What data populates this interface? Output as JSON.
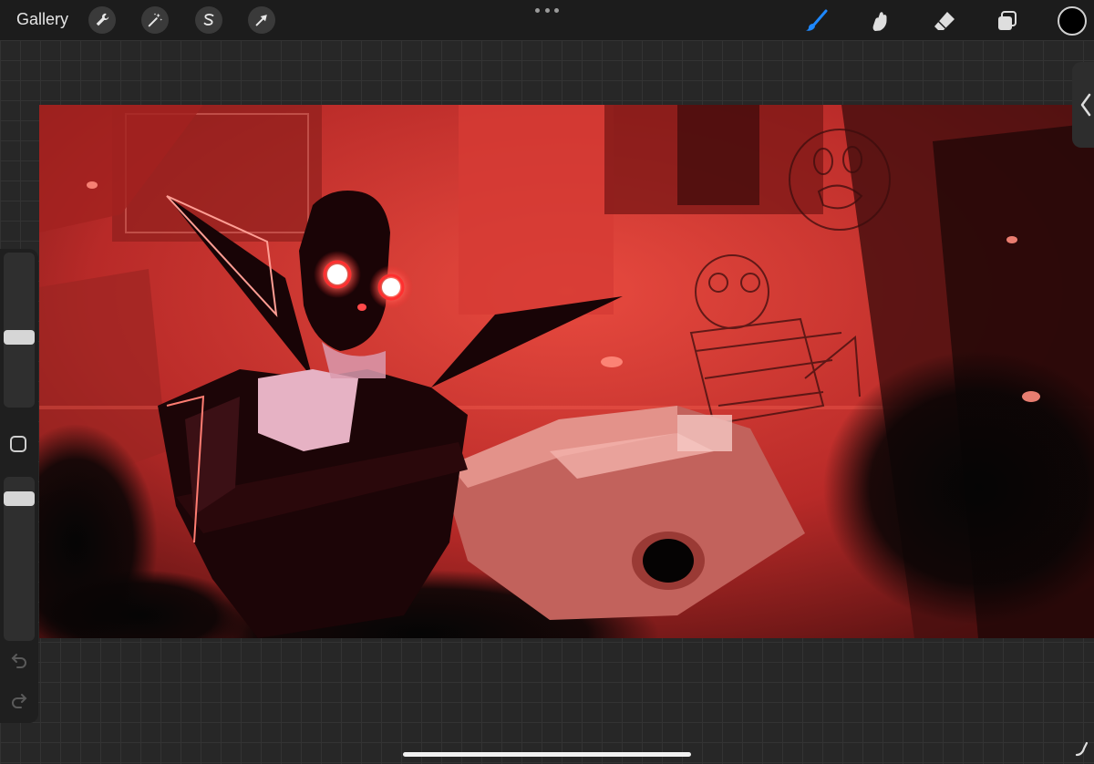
{
  "toolbar": {
    "gallery_label": "Gallery",
    "left_tools": [
      "wrench-icon",
      "magic-wand-icon",
      "selection-icon",
      "transform-arrow-icon"
    ],
    "right_tools": [
      "brush-icon",
      "smudge-icon",
      "eraser-icon",
      "layers-icon"
    ],
    "active_tool": "brush",
    "active_tool_color": "#1e88ff",
    "current_color": "#000000"
  },
  "sidebar": {
    "brush_size_level": 0.45,
    "opacity_level": 0.9,
    "controls": [
      "brush-size-slider",
      "modify-button",
      "opacity-slider",
      "undo-icon",
      "redo-icon"
    ]
  },
  "canvas": {
    "dominant_color": "#c8302d",
    "accent_color": "#ff5a4a"
  }
}
